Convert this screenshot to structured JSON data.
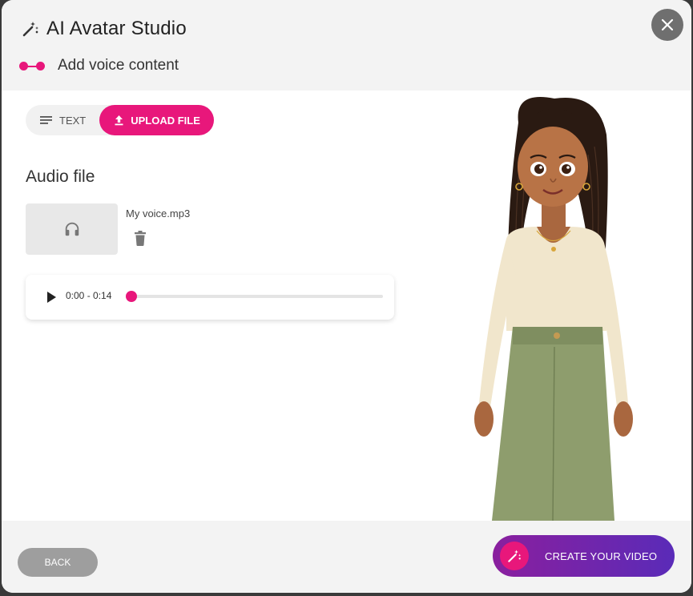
{
  "header": {
    "title": "AI Avatar Studio",
    "step_label": "Add voice content"
  },
  "tabs": [
    {
      "label": "TEXT",
      "icon": "text-lines-icon",
      "active": false
    },
    {
      "label": "UPLOAD FILE",
      "icon": "upload-icon",
      "active": true
    }
  ],
  "audio": {
    "section_title": "Audio file",
    "file_name": "My voice.mp3",
    "time": "0:00 - 0:14",
    "progress": 0
  },
  "footer": {
    "back_label": "BACK",
    "create_label": "CREATE YOUR VIDEO"
  },
  "colors": {
    "accent": "#e8177b",
    "create_gradient_start": "#8a1f9e",
    "create_gradient_end": "#5a2bb8"
  }
}
